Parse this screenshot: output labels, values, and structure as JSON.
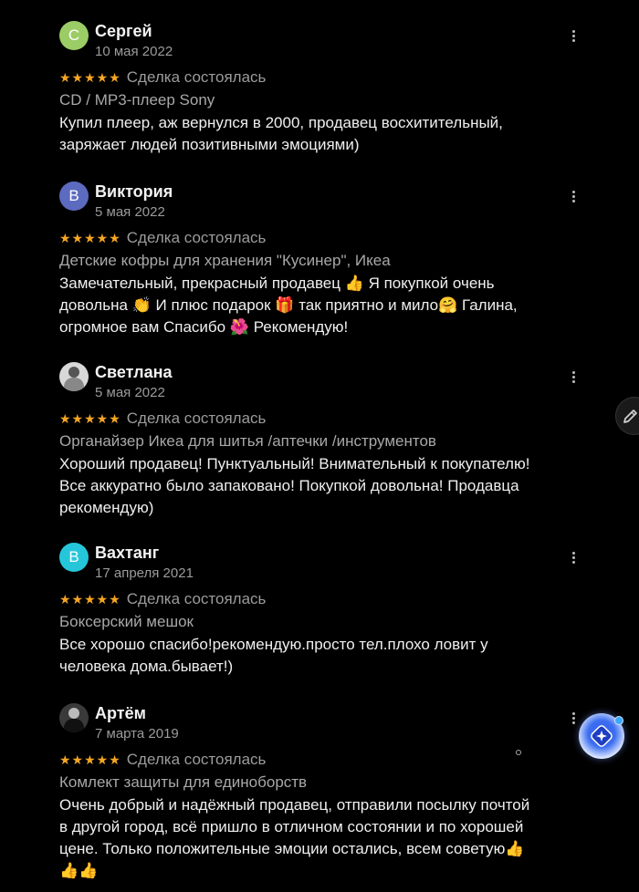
{
  "reviews": [
    {
      "initial": "С",
      "avatar_color": "#9ccc65",
      "name": "Сергей",
      "date": "10 мая 2022",
      "stars": "★★★★★",
      "deal_status": "Сделка состоялась",
      "product": "CD / MP3-плеер Sony",
      "text": "Купил плеер, аж вернулся в 2000, продавец восхитительный,\nзаряжает людей позитивными эмоциями)"
    },
    {
      "initial": "В",
      "avatar_color": "#5c6bc0",
      "name": "Виктория",
      "date": "5 мая 2022",
      "stars": "★★★★★",
      "deal_status": "Сделка состоялась",
      "product": "Детские кофры для хранения \"Кусинер\", Икеа",
      "text": "Замечательный, прекрасный продавец 👍 Я покупкой очень\nдовольна 👏 И плюс подарок 🎁 так приятно и мило🤗 Галина,\nогромное вам Спасибо 🌺 Рекомендую!"
    },
    {
      "initial": "",
      "avatar_color": "#d8d8d8",
      "name": "Светлана",
      "date": "5 мая 2022",
      "stars": "★★★★★",
      "deal_status": "Сделка состоялась",
      "product": "Органайзер Икеа для шитья /аптечки /инструментов",
      "text": "Хороший продавец! Пунктуальный! Внимательный к покупателю!\nВсе аккуратно было запаковано! Покупкой довольна! Продавца\nрекомендую)"
    },
    {
      "initial": "В",
      "avatar_color": "#26c6da",
      "name": "Вахтанг",
      "date": "17 апреля 2021",
      "stars": "★★★★★",
      "deal_status": "Сделка состоялась",
      "product": "Боксерский мешок",
      "text": "Все хорошо спасибо!рекомендую.просто тел.плохо ловит у\nчеловека дома.бывает!)"
    },
    {
      "initial": "",
      "avatar_color": "#3a3a3a",
      "name": "Артём",
      "date": "7 марта 2019",
      "stars": "★★★★★",
      "deal_status": "Сделка состоялась",
      "product": "Комлект защиты для единоборств",
      "text": "Очень добрый и надёжный продавец, отправили посылку почтой\nв другой город, всё пришло в отличном состоянии и по хорошей\nцене. Только положительные эмоции остались, всем советую👍\n👍👍"
    }
  ],
  "icons": {
    "menu": "more-vertical-icon",
    "edit": "pencil-icon",
    "assistant": "sparkle-icon"
  }
}
